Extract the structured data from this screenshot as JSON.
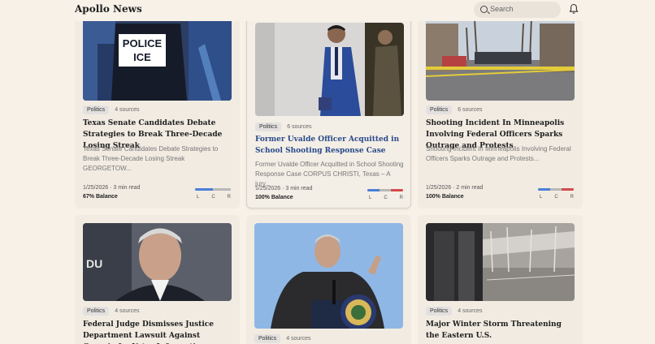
{
  "header": {
    "brand": "Apollo News",
    "search_placeholder": "Search"
  },
  "cards": [
    {
      "category": "Politics",
      "sources": "4 sources",
      "title": "Texas Senate Candidates Debate Strategies to Break Three-Decade Losing Streak",
      "summary": "Texas Senate Candidates Debate Strategies to Break Three-Decade Losing Streak GEORGETOW...",
      "meta": "1/25/2026 · 3 min read",
      "balance": "67% Balance",
      "bias": {
        "left": 0.5,
        "center": 0.5,
        "right": 0
      }
    },
    {
      "category": "Politics",
      "sources": "6 sources",
      "title": "Former Uvalde Officer Acquitted in School Shooting Response Case",
      "summary": "Former Uvalde Officer Acquitted in School Shooting Response Case CORPUS CHRISTI, Texas – A jury...",
      "meta": "1/25/2026 · 3 min read",
      "balance": "100% Balance",
      "bias": {
        "left": 0.34,
        "center": 0.33,
        "right": 0.33
      }
    },
    {
      "category": "Politics",
      "sources": "6 sources",
      "title": "Shooting Incident In Minneapolis Involving Federal Officers Sparks Outrage and Protests",
      "summary": "Shooting Incident In Minneapolis Involving Federal Officers Sparks Outrage and Protests...",
      "meta": "1/25/2026 · 2 min read",
      "balance": "100% Balance",
      "bias": {
        "left": 0.34,
        "center": 0.33,
        "right": 0.33
      }
    },
    {
      "category": "Politics",
      "sources": "4 sources",
      "title": "Federal Judge Dismisses Justice Department Lawsuit Against Georgia for Voter Information"
    },
    {
      "category": "Politics",
      "sources": "4 sources",
      "title": ""
    },
    {
      "category": "Politics",
      "sources": "4 sources",
      "title": "Major Winter Storm Threatening the Eastern U.S."
    }
  ],
  "bias_labels": {
    "l": "L",
    "c": "C",
    "r": "R"
  }
}
